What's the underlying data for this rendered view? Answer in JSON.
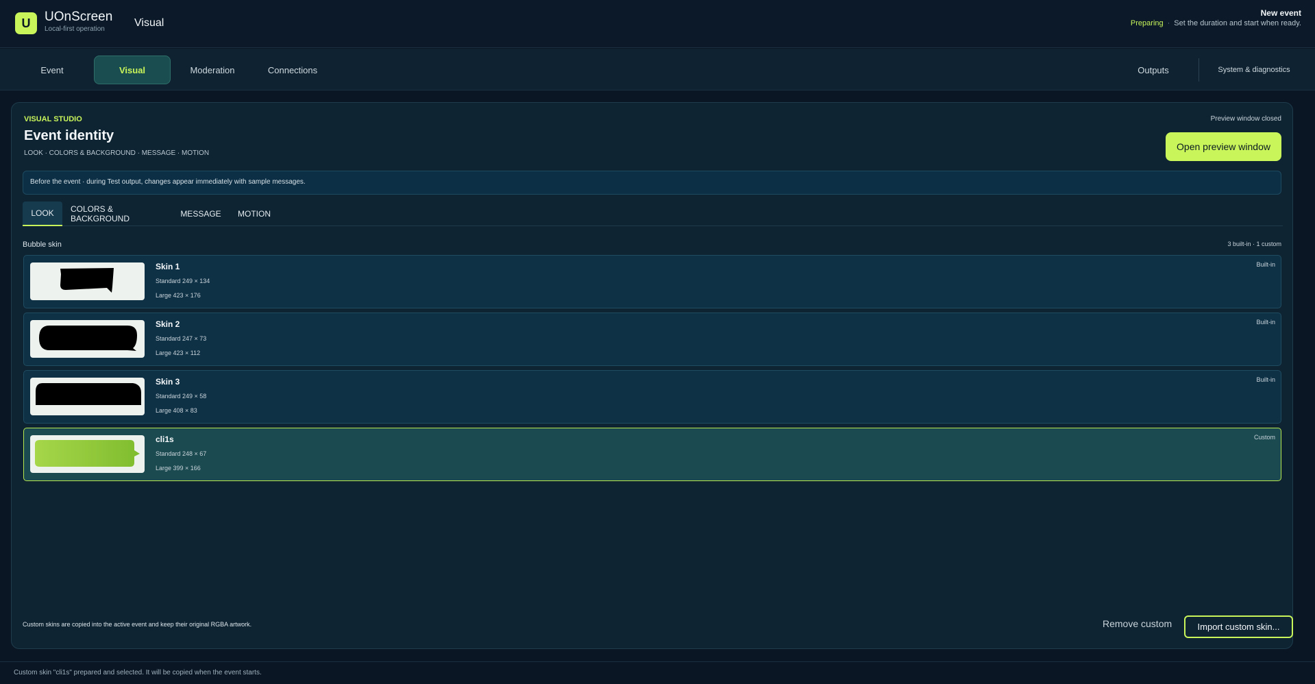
{
  "header": {
    "logo_letter": "U",
    "app_name": "UOnScreen",
    "app_subtitle": "Local-first operation",
    "page_title": "Visual",
    "event_title": "New event",
    "status_state": "Preparing",
    "status_separator": "·",
    "status_message": "Set the duration and start when ready."
  },
  "nav": {
    "tabs": [
      {
        "label": "Event"
      },
      {
        "label": "Visual"
      },
      {
        "label": "Moderation"
      },
      {
        "label": "Connections"
      },
      {
        "label": "Outputs"
      },
      {
        "label": "System & diagnostics"
      }
    ],
    "active": "Visual"
  },
  "studio": {
    "label": "VISUAL STUDIO",
    "title": "Event identity",
    "subtitle": "LOOK · COLORS & BACKGROUND · MESSAGE · MOTION",
    "preview_status": "Preview window closed",
    "open_preview_label": "Open preview window",
    "info_text": "Before the event · during Test output, changes appear immediately with sample messages.",
    "sub_tabs": [
      {
        "label": "LOOK"
      },
      {
        "label": "COLORS & BACKGROUND"
      },
      {
        "label": "MESSAGE"
      },
      {
        "label": "MOTION"
      }
    ],
    "active_sub_tab": "LOOK",
    "section_label": "Bubble skin",
    "skin_count": "3 built-in · 1 custom",
    "skins": [
      {
        "name": "Skin 1",
        "standard": "Standard  249 × 134",
        "large": "Large  423 × 176",
        "type": "Built-in"
      },
      {
        "name": "Skin 2",
        "standard": "Standard  247 × 73",
        "large": "Large  423 × 112",
        "type": "Built-in"
      },
      {
        "name": "Skin 3",
        "standard": "Standard  249 × 58",
        "large": "Large  408 × 83",
        "type": "Built-in"
      },
      {
        "name": "cli1s",
        "standard": "Standard  248 × 67",
        "large": "Large  399 × 166",
        "type": "Custom"
      }
    ],
    "selected_skin": "cli1s",
    "footer_note": "Custom skins are copied into the active event and keep their original RGBA artwork.",
    "remove_label": "Remove custom",
    "import_label": "Import custom skin..."
  },
  "statusbar": {
    "message": "Custom skin \"cli1s\" prepared and selected. It will be copied when the event starts."
  },
  "colors": {
    "accent": "#c9f55a",
    "background": "#0a1624",
    "panel": "#0e2433"
  }
}
